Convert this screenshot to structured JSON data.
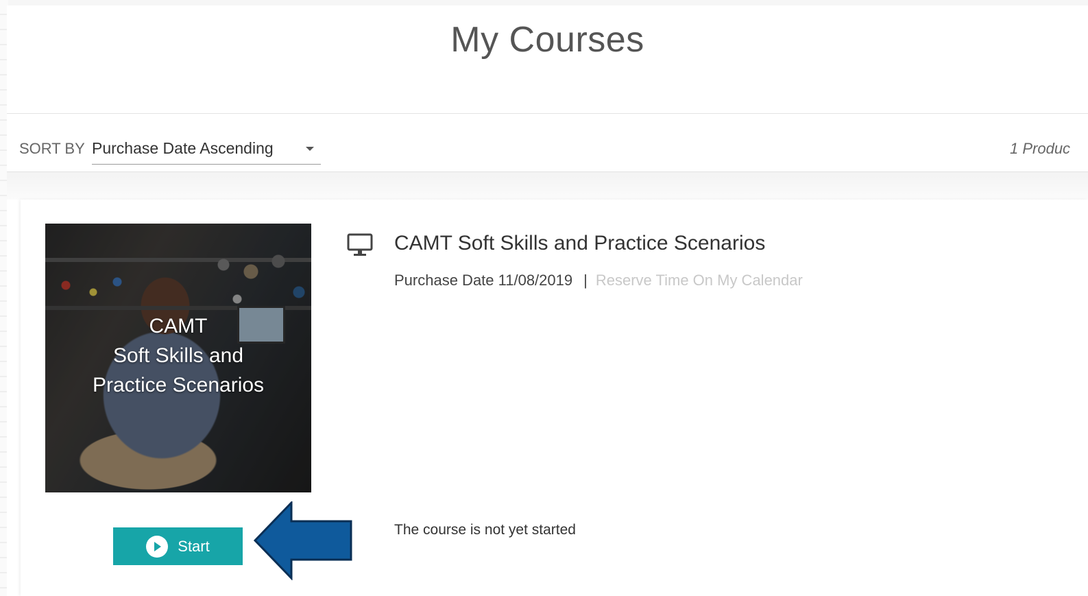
{
  "page": {
    "title": "My Courses"
  },
  "sort": {
    "label": "SORT BY",
    "selected": "Purchase Date Ascending"
  },
  "results": {
    "count_text": "1 Produc"
  },
  "course": {
    "thumbnail_text": [
      "CAMT",
      "Soft Skills and",
      "Practice Scenarios"
    ],
    "type_icon": "desktop-monitor-icon",
    "title": "CAMT Soft Skills and Practice Scenarios",
    "purchase_date_label": "Purchase Date 11/08/2019",
    "separator": "|",
    "reserve_link": "Reserve Time On My Calendar",
    "status": "The course is not yet started",
    "start_label": "Start"
  },
  "colors": {
    "accent": "#17a5a8",
    "arrow": "#0f5a9c"
  }
}
